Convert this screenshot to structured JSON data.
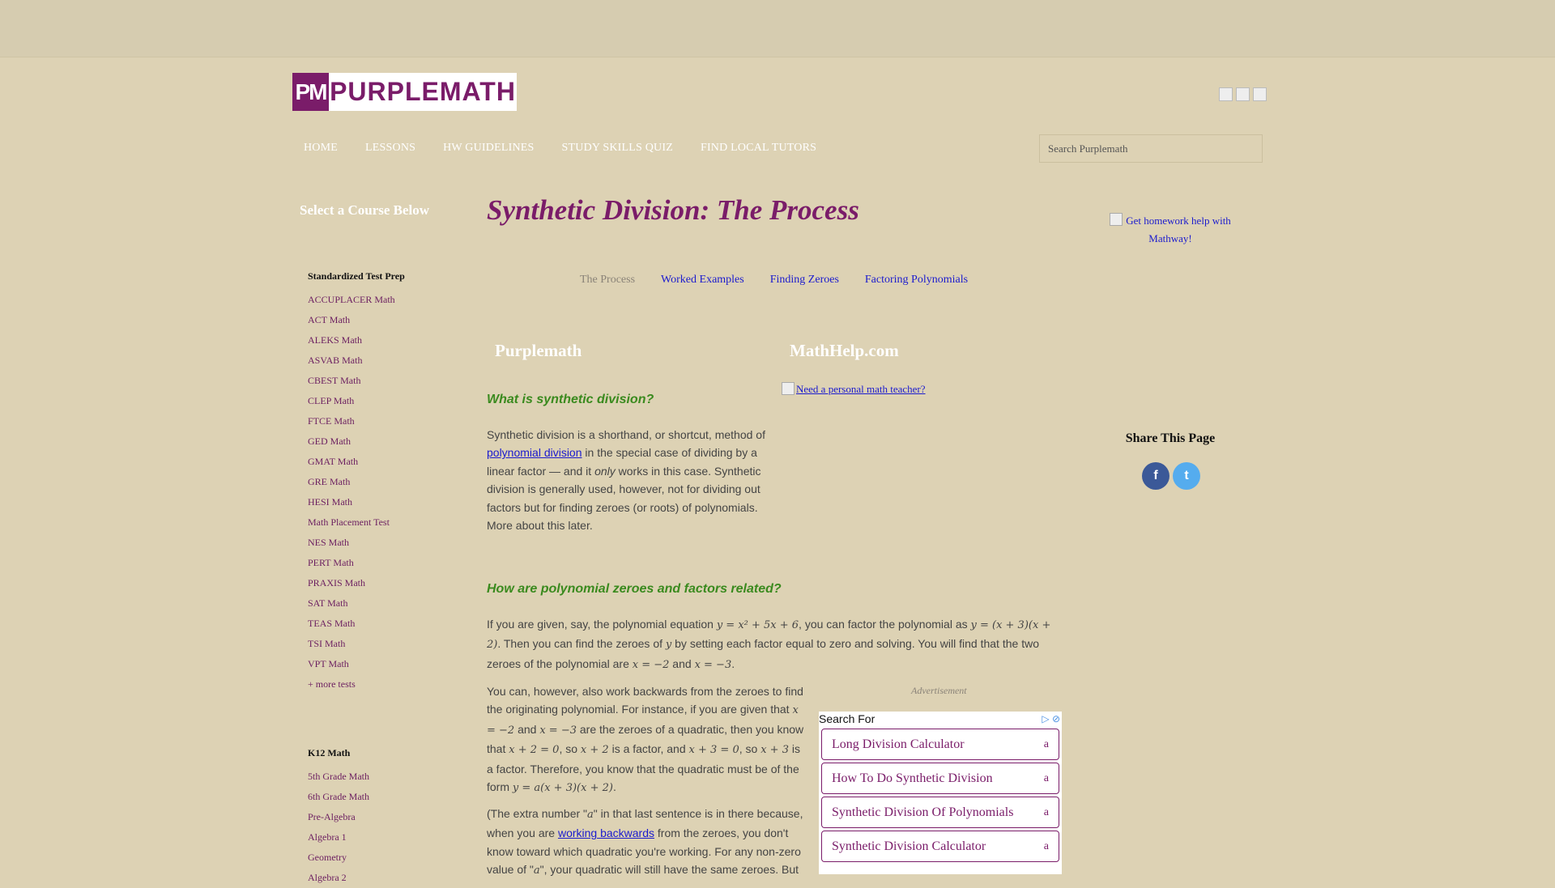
{
  "header": {
    "logo_mark": "PM",
    "logo_text": "PURPLEMATH",
    "search_placeholder": "Search Purplemath"
  },
  "nav": [
    "HOME",
    "LESSONS",
    "HW GUIDELINES",
    "STUDY SKILLS QUIZ",
    "FIND LOCAL TUTORS"
  ],
  "sidebar": {
    "title": "Select a Course Below",
    "groups": [
      {
        "heading": "Standardized Test Prep",
        "items": [
          "ACCUPLACER Math",
          "ACT Math",
          "ALEKS Math",
          "ASVAB Math",
          "CBEST Math",
          "CLEP Math",
          "FTCE Math",
          "GED Math",
          "GMAT Math",
          "GRE Math",
          "HESI Math",
          "Math Placement Test",
          "NES Math",
          "PERT Math",
          "PRAXIS Math",
          "SAT Math",
          "TEAS Math",
          "TSI Math",
          "VPT Math",
          "+ more tests"
        ]
      },
      {
        "heading": "K12 Math",
        "items": [
          "5th Grade Math",
          "6th Grade Math",
          "Pre-Algebra",
          "Algebra 1",
          "Geometry",
          "Algebra 2"
        ]
      }
    ]
  },
  "main": {
    "title": "Synthetic Division: The Process",
    "subnav": [
      "The Process",
      "Worked Examples",
      "Finding Zeroes",
      "Factoring Polynomials"
    ],
    "col_left_heading": "Purplemath",
    "col_right_heading": "MathHelp.com",
    "promo_link": "Need a personal math teacher?",
    "section1_heading": "What is synthetic division?",
    "p1": {
      "a": "Synthetic division is a shorthand, or shortcut, method of",
      "link": "polynomial division",
      "b": " in the special case of dividing by a linear factor — and it ",
      "em": "only",
      "c": " works in this case. Synthetic division is generally used, however, not for dividing out factors but for finding zeroes (or roots) of polynomials. More about this later."
    },
    "section2_heading": "How are polynomial zeroes and factors related?",
    "p2": {
      "a": "If you are given, say, the polynomial equation ",
      "m1": "y = x² + 5x + 6",
      "b": ", you can factor the polynomial as ",
      "m2": "y = (x + 3)(x + 2)",
      "c": ". Then you can find the zeroes of ",
      "m3": "y",
      "d": " by setting each factor equal to zero and solving. You will find that the two zeroes of the polynomial are ",
      "m4": "x = −2",
      "e": " and ",
      "m5": "x = −3",
      "f": "."
    },
    "p3": {
      "a": "You can, however, also work backwards from the zeroes to find the originating polynomial. For instance, if you are given that ",
      "m1": "x = −2",
      "b": " and ",
      "m2": "x = −3",
      "c": " are the zeroes of a quadratic, then you know that ",
      "m3": "x + 2 = 0",
      "d": ", so ",
      "m4": "x + 2",
      "e": " is a factor, and ",
      "m5": "x + 3 = 0",
      "f": ", so ",
      "m6": "x + 3",
      "g": " is a factor. Therefore, you know that the quadratic must be of the form ",
      "m7": "y = a(x + 3)(x + 2)",
      "h": "."
    },
    "p4": {
      "a": "(The extra number \"",
      "m1": "a",
      "b": "\" in that last sentence is in there because, when you are ",
      "link": "working backwards",
      "c": " from the zeroes, you don't know toward which quadratic you're working. For any non-zero value of \"",
      "m2": "a",
      "d": "\", your quadratic will still have the same zeroes. But"
    }
  },
  "ad": {
    "label": "Advertisement",
    "header": "Search For",
    "items": [
      "Long Division Calculator",
      "How To Do Synthetic Division",
      "Synthetic Division Of Polynomials",
      "Synthetic Division Calculator"
    ]
  },
  "right": {
    "mathway_text": "Get homework help with Mathway!",
    "share_heading": "Share This Page"
  }
}
